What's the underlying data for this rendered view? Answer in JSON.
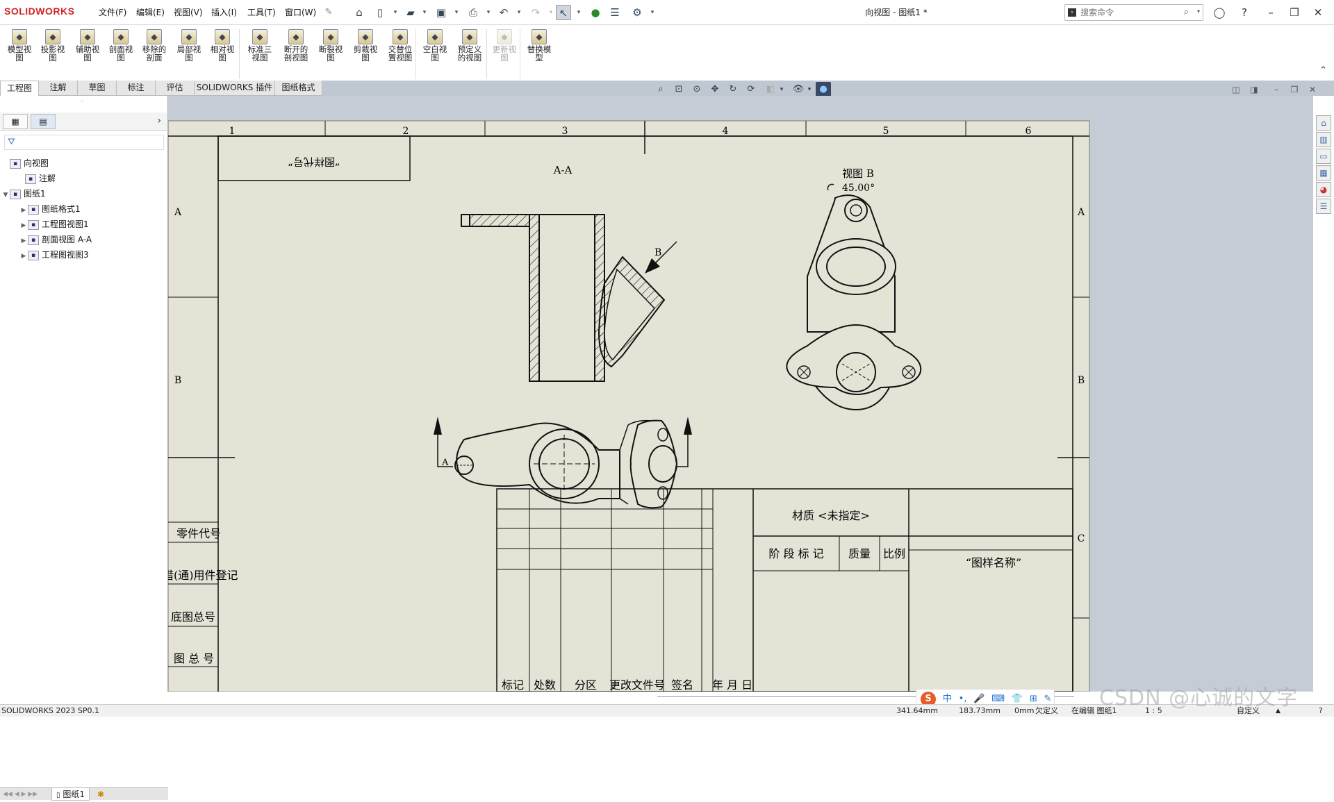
{
  "app": {
    "logo": "SOLIDWORKS",
    "document_title": "向视图 - 图纸1 *"
  },
  "menu": [
    "文件(F)",
    "编辑(E)",
    "视图(V)",
    "插入(I)",
    "工具(T)",
    "窗口(W)"
  ],
  "search": {
    "placeholder": "搜索命令"
  },
  "ribbon": [
    {
      "label": "模型视\n图",
      "icon": "model-view-icon",
      "enabled": true
    },
    {
      "label": "投影视\n图",
      "icon": "projected-view-icon",
      "enabled": true
    },
    {
      "label": "辅助视\n图",
      "icon": "auxiliary-view-icon",
      "enabled": true
    },
    {
      "label": "剖面视\n图",
      "icon": "section-view-icon",
      "enabled": true
    },
    {
      "label": "移除的\n剖面",
      "icon": "removed-section-icon",
      "enabled": true
    },
    {
      "label": "局部视\n图",
      "icon": "detail-view-icon",
      "enabled": true
    },
    {
      "label": "相对视\n图",
      "icon": "relative-view-icon",
      "enabled": true
    },
    {
      "label": "标准三\n视图",
      "icon": "standard-3-view-icon",
      "enabled": true
    },
    {
      "label": "断开的\n剖视图",
      "icon": "broken-out-section-icon",
      "enabled": true
    },
    {
      "label": "断裂视\n图",
      "icon": "break-view-icon",
      "enabled": true
    },
    {
      "label": "剪裁视\n图",
      "icon": "crop-view-icon",
      "enabled": true
    },
    {
      "label": "交替位\n置视图",
      "icon": "alternate-position-icon",
      "enabled": true
    },
    {
      "label": "空白视\n图",
      "icon": "empty-view-icon",
      "enabled": true
    },
    {
      "label": "预定义\n的视图",
      "icon": "predefined-view-icon",
      "enabled": true
    },
    {
      "label": "更新视\n图",
      "icon": "update-view-icon",
      "enabled": false
    },
    {
      "label": "替换模\n型",
      "icon": "replace-model-icon",
      "enabled": true
    }
  ],
  "command_tabs": [
    "工程图",
    "注解",
    "草图",
    "标注",
    "评估",
    "SOLIDWORKS 插件",
    "图纸格式"
  ],
  "tree": [
    {
      "label": "向视图",
      "icon": "drawing-icon",
      "level": 0,
      "toggle": ""
    },
    {
      "label": "注解",
      "icon": "annotation-icon",
      "level": 1,
      "toggle": ""
    },
    {
      "label": "图纸1",
      "icon": "sheet-icon",
      "level": 0,
      "toggle": "▼"
    },
    {
      "label": "图纸格式1",
      "icon": "sheet-format-icon",
      "level": 2,
      "toggle": "▶"
    },
    {
      "label": "工程图视图1",
      "icon": "drawing-view-icon",
      "level": 2,
      "toggle": "▶"
    },
    {
      "label": "剖面视图 A-A",
      "icon": "section-view-icon",
      "level": 2,
      "toggle": "▶"
    },
    {
      "label": "工程图视图3",
      "icon": "drawing-view-icon",
      "level": 2,
      "toggle": "▶"
    }
  ],
  "sheet_tab": "图纸1",
  "drawing": {
    "zone_cols": [
      "1",
      "2",
      "3",
      "4",
      "5",
      "6"
    ],
    "zone_rows": [
      "A",
      "B",
      "C"
    ],
    "section_label": "A-A",
    "view_b_label": "视图 B",
    "view_b_angle": "45.00°",
    "arrow_b": "B",
    "cut_a_left": "A",
    "cut_a_right": "A",
    "mirrored_code": "“图样代号”",
    "left_labels": [
      "借(通)用件登记",
      "底图总号",
      "图 总 号",
      "零件代号"
    ],
    "title_block": {
      "material": "材质 <未指定>",
      "headers": [
        "标记",
        "处数",
        "分区",
        "更改文件号",
        "签名",
        "年 月 日"
      ],
      "stage": "阶 段 标 记",
      "mass": "质量",
      "scale": "比例",
      "drawing_name": "“图样名称”"
    }
  },
  "status": {
    "version": "SOLIDWORKS 2023 SP0.1",
    "x": "341.64mm",
    "y": "183.73mm",
    "z": "0mm",
    "defined": "欠定义",
    "mode": "在编辑 图纸1",
    "scale": "1 : 5",
    "units": "自定义"
  },
  "ime": [
    "中",
    "•,",
    "🎤",
    "⌨",
    "👕",
    "⊞",
    "✎"
  ],
  "watermark": "CSDN @心诚的文字"
}
